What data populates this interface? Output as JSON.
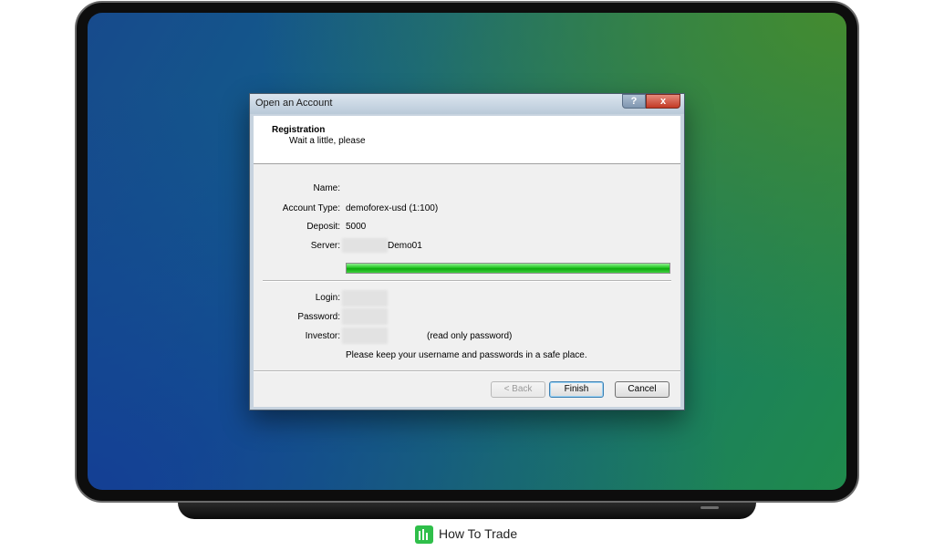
{
  "dialog": {
    "title": "Open an Account",
    "help_label": "?",
    "close_label": "x",
    "header": {
      "title": "Registration",
      "subtitle": "Wait a little, please"
    },
    "fields": {
      "name_label": "Name:",
      "name_value": "",
      "account_type_label": "Account Type:",
      "account_type_value": "demoforex-usd (1:100)",
      "deposit_label": "Deposit:",
      "deposit_value": "5000",
      "server_label": "Server:",
      "server_value_suffix": "Demo01",
      "login_label": "Login:",
      "password_label": "Password:",
      "investor_label": "Investor:",
      "investor_note": "(read only password)",
      "keep_safe_note": "Please keep your username and passwords in a safe place."
    },
    "progress": {
      "fraction": 1.0,
      "color": "#22c722"
    },
    "buttons": {
      "back_label": "< Back",
      "finish_label": "Finish",
      "cancel_label": "Cancel"
    }
  },
  "brand": {
    "name": "How To Trade",
    "logo_icon": "bar-chart-icon",
    "color": "#2fbf4a"
  }
}
